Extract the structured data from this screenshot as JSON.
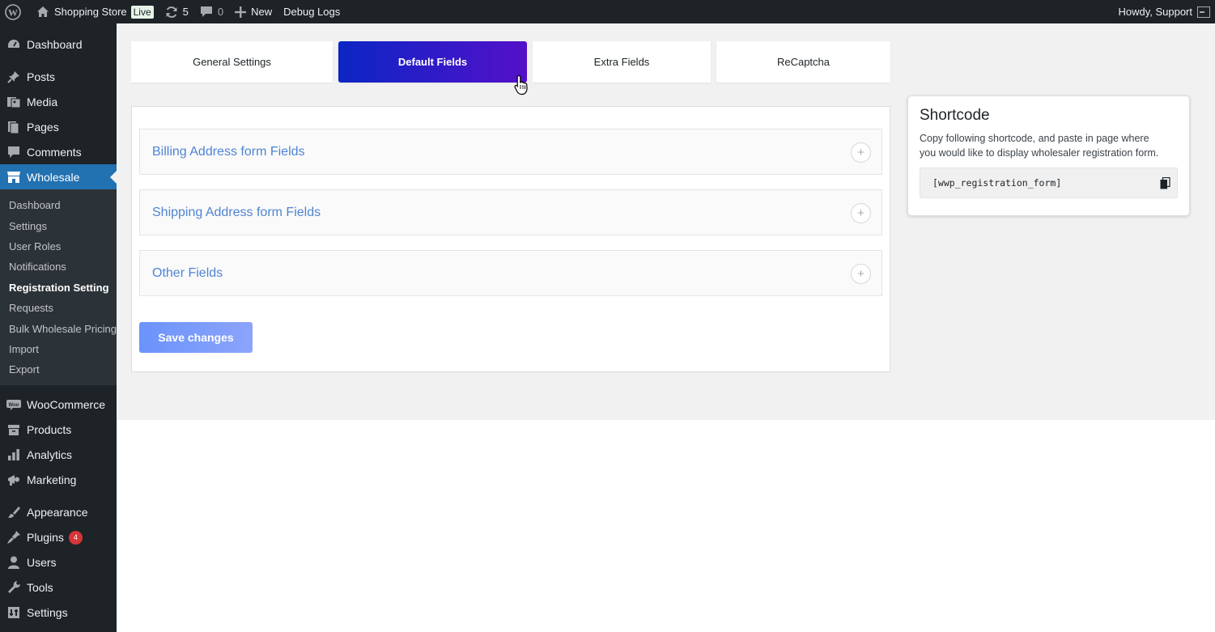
{
  "adminbar": {
    "site_name": "Shopping Store",
    "live_label": "Live",
    "updates_count": "5",
    "comments_count": "0",
    "new_label": "New",
    "debug_label": "Debug Logs",
    "howdy": "Howdy, Support"
  },
  "sidebar": {
    "top": [
      {
        "label": "Dashboard",
        "icon": "dashboard-icon"
      },
      {
        "label": "Posts",
        "icon": "pin-icon"
      },
      {
        "label": "Media",
        "icon": "media-icon"
      },
      {
        "label": "Pages",
        "icon": "pages-icon"
      },
      {
        "label": "Comments",
        "icon": "comments-icon"
      },
      {
        "label": "Wholesale",
        "icon": "store-icon"
      }
    ],
    "submenu": [
      "Dashboard",
      "Settings",
      "User Roles",
      "Notifications",
      "Registration Setting",
      "Requests",
      "Bulk Wholesale Pricing",
      "Import",
      "Export"
    ],
    "bottom": [
      {
        "label": "WooCommerce",
        "icon": "woo-icon"
      },
      {
        "label": "Products",
        "icon": "products-icon"
      },
      {
        "label": "Analytics",
        "icon": "analytics-icon"
      },
      {
        "label": "Marketing",
        "icon": "megaphone-icon"
      },
      {
        "label": "Appearance",
        "icon": "brush-icon"
      },
      {
        "label": "Plugins",
        "icon": "plugin-icon",
        "badge": "4"
      },
      {
        "label": "Users",
        "icon": "user-icon"
      },
      {
        "label": "Tools",
        "icon": "wrench-icon"
      },
      {
        "label": "Settings",
        "icon": "settings-icon"
      }
    ]
  },
  "tabs": [
    "General Settings",
    "Default Fields",
    "Extra Fields",
    "ReCaptcha"
  ],
  "active_tab": "Default Fields",
  "accordion": [
    "Billing Address form Fields",
    "Shipping Address form Fields",
    "Other Fields"
  ],
  "save_label": "Save changes",
  "shortcode": {
    "title": "Shortcode",
    "description": "Copy following shortcode, and paste in page where you would like to display wholesaler registration form.",
    "code": "[wwp_registration_form]"
  },
  "colors": {
    "admin_dark": "#1d2327",
    "admin_blue": "#2271b1",
    "tab_gradient_start": "#0b26c4",
    "tab_gradient_end": "#5410c9",
    "accordion_text": "#4f84d3",
    "save_button": "#7b9cfb",
    "badge_red": "#d63638"
  }
}
